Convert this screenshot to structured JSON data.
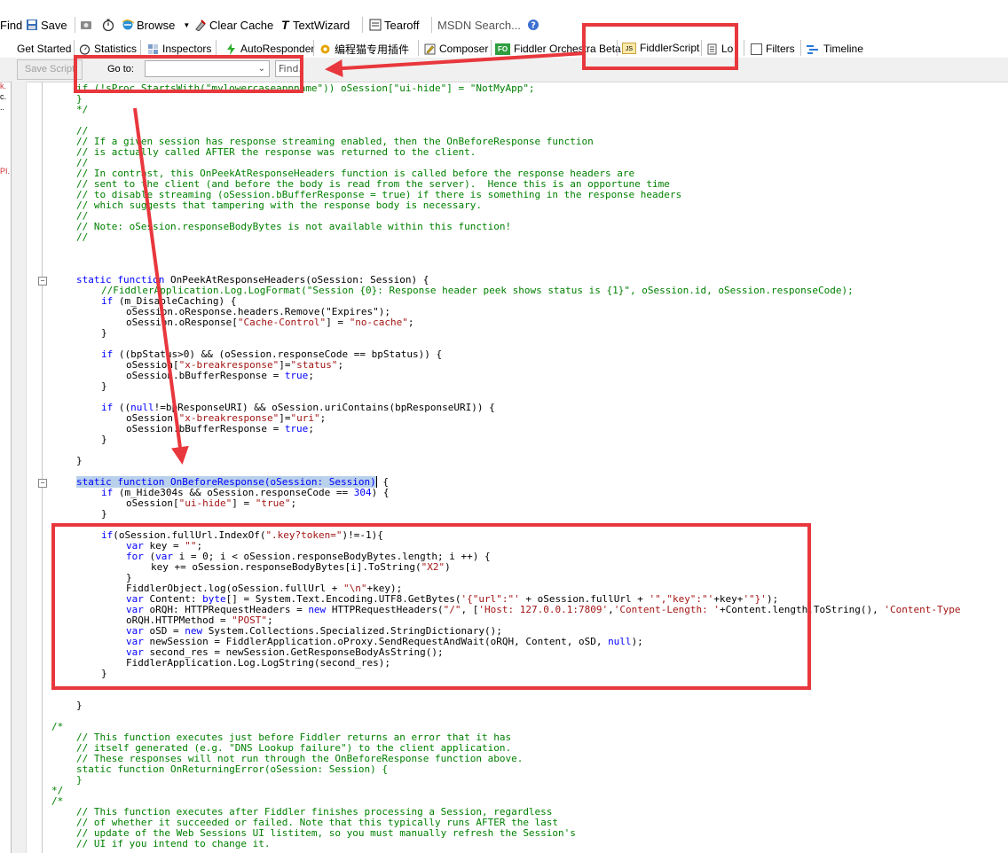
{
  "toolbar": {
    "find_label": "Find",
    "save_label": "Save",
    "statistics_icon": "camera-icon",
    "browse_label": "Browse",
    "clear_cache_label": "Clear Cache",
    "textwizard_label": "TextWizard",
    "tearoff_label": "Tearoff",
    "msdn_search_label": "MSDN Search...",
    "help_icon": "help-icon"
  },
  "tabs": [
    {
      "label": "Get Started"
    },
    {
      "label": "Statistics"
    },
    {
      "label": "Inspectors"
    },
    {
      "label": "AutoResponder"
    },
    {
      "label": "编程猫专用插件"
    },
    {
      "label": "Composer"
    },
    {
      "label": "Fiddler Orchestra Beta"
    },
    {
      "label": "FiddlerScript"
    },
    {
      "label": "Lo"
    },
    {
      "label": "Filters"
    },
    {
      "label": "Timeline"
    }
  ],
  "tab_badges": {
    "fo": "FO",
    "js": "JS"
  },
  "scriptbar": {
    "save_script_label": "Save Script",
    "goto_label": "Go to:",
    "goto_value": "",
    "find_placeholder": "Find..."
  },
  "left_strip": [
    "k.",
    "c.",
    "..",
    "PI."
  ],
  "colors": {
    "annotation_red": "#e8373d",
    "comment": "#008000",
    "keyword": "#0000ff",
    "string": "#a31515",
    "selection": "#b9d1ea"
  },
  "code": {
    "l0": "if (!sProc.StartsWith(\"mylowercaseappname\")) oSession[\"ui-hide\"] = \"NotMyApp\";",
    "l1": "}",
    "l2": "*/",
    "l3": "//",
    "l4": "// If a given session has response streaming enabled, then the OnBeforeResponse function",
    "l5": "// is actually called AFTER the response was returned to the client.",
    "l6": "//",
    "l7": "// In contrast, this OnPeekAtResponseHeaders function is called before the response headers are",
    "l8": "// sent to the client (and before the body is read from the server).  Hence this is an opportune time",
    "l9": "// to disable streaming (oSession.bBufferResponse = true) if there is something in the response headers",
    "l10": "// which suggests that tampering with the response body is necessary.",
    "l11": "//",
    "l12": "// Note: oSession.responseBodyBytes is not available within this function!",
    "l13": "//",
    "l14a": "static function ",
    "l14b": "OnPeekAtResponseHeaders(oSession: Session) {",
    "l15": "//FiddlerApplication.Log.LogFormat(\"Session {0}: Response header peek shows status is {1}\", oSession.id, oSession.responseCode);",
    "l16a": "if ",
    "l16b": "(m_DisableCaching) {",
    "l17": "oSession.oResponse.headers.Remove(\"Expires\");",
    "l18a": "oSession.oResponse[",
    "l18b": "\"Cache-Control\"",
    "l18c": "] = ",
    "l18d": "\"no-cache\"",
    "l18e": ";",
    "l19": "}",
    "l20a": "if ",
    "l20b": "((bpStatus>0) && (oSession.responseCode == bpStatus)) {",
    "l21a": "oSession[",
    "l21b": "\"x-breakresponse\"",
    "l21c": "]=",
    "l21d": "\"status\"",
    "l21e": ";",
    "l22a": "oSession.bBufferResponse = ",
    "l22b": "true",
    "l22c": ";",
    "l23": "}",
    "l24a": "if ",
    "l24b": "((",
    "l24c": "null",
    "l24d": "!=bpResponseURI) && oSession.uriContains(bpResponseURI)) {",
    "l25a": "oSession[",
    "l25b": "\"x-breakresponse\"",
    "l25c": "]=",
    "l25d": "\"uri\"",
    "l25e": ";",
    "l26a": "oSession.bBufferResponse = ",
    "l26b": "true",
    "l26c": ";",
    "l27": "}",
    "l28": "}",
    "l29": "static function OnBeforeResponse(oSession: Session)",
    "l29b": " {",
    "l30a": "if ",
    "l30b": "(m_Hide304s && oSession.responseCode == ",
    "l30c": "304",
    "l30d": ") {",
    "l31a": "oSession[",
    "l31b": "\"ui-hide\"",
    "l31c": "] = ",
    "l31d": "\"true\"",
    "l31e": ";",
    "l32": "}",
    "l33a": "if",
    "l33b": "(oSession.fullUrl.IndexOf(",
    "l33c": "\".key?token=\"",
    "l33d": ")!=-1){",
    "l34a": "var ",
    "l34b": "key = ",
    "l34c": "\"\"",
    "l34d": ";",
    "l35a": "for ",
    "l35b": "(",
    "l35c": "var ",
    "l35d": "i = 0; i < oSession.responseBodyBytes.length; i ++) {",
    "l36a": "key += oSession.responseBodyBytes[i].ToString(",
    "l36b": "\"X2\"",
    "l36c": ")",
    "l37": "}",
    "l38a": "FiddlerObject.log(oSession.fullUrl + ",
    "l38b": "\"\\n\"",
    "l38c": "+key);",
    "l39a": "var ",
    "l39b": "Content: ",
    "l39c": "byte",
    "l39d": "[] = System.Text.Encoding.UTF8.GetBytes(",
    "l39e": "'{\"url\":\"'",
    "l39f": " + oSession.fullUrl + ",
    "l39g": "'\",\"key\":\"'",
    "l39h": "+key+",
    "l39i": "'\"}'",
    "l39j": ");",
    "l40a": "var ",
    "l40b": "oRQH: HTTPRequestHeaders = ",
    "l40c": "new ",
    "l40d": "HTTPRequestHeaders(",
    "l40e": "\"/\"",
    "l40f": ", [",
    "l40g": "'Host: 127.0.0.1:7809'",
    "l40h": ",",
    "l40i": "'Content-Length: '",
    "l40j": "+Content.length.ToString(), ",
    "l40k": "'Content-Type",
    "l41a": "oRQH.HTTPMethod = ",
    "l41b": "\"POST\"",
    "l41c": ";",
    "l42a": "var ",
    "l42b": "oSD = ",
    "l42c": "new ",
    "l42d": "System.Collections.Specialized.StringDictionary();",
    "l43a": "var ",
    "l43b": "newSession = FiddlerApplication.oProxy.SendRequestAndWait(oRQH, Content, oSD, ",
    "l43c": "null",
    "l43d": ");",
    "l44a": "var ",
    "l44b": "second_res = newSession.GetResponseBodyAsString();",
    "l45": "FiddlerApplication.Log.LogString(second_res);",
    "l46": "}",
    "l47": "}",
    "l48": "/*",
    "l49": "// This function executes just before Fiddler returns an error that it has",
    "l50": "// itself generated (e.g. \"DNS Lookup failure\") to the client application.",
    "l51": "// These responses will not run through the OnBeforeResponse function above.",
    "l52": "static function OnReturningError(oSession: Session) {",
    "l53": "}",
    "l54": "*/",
    "l55": "/*",
    "l56": "// This function executes after Fiddler finishes processing a Session, regardless",
    "l57": "// of whether it succeeded or failed. Note that this typically runs AFTER the last",
    "l58": "// update of the Web Sessions UI listitem, so you must manually refresh the Session's",
    "l59": "// UI if you intend to change it."
  }
}
